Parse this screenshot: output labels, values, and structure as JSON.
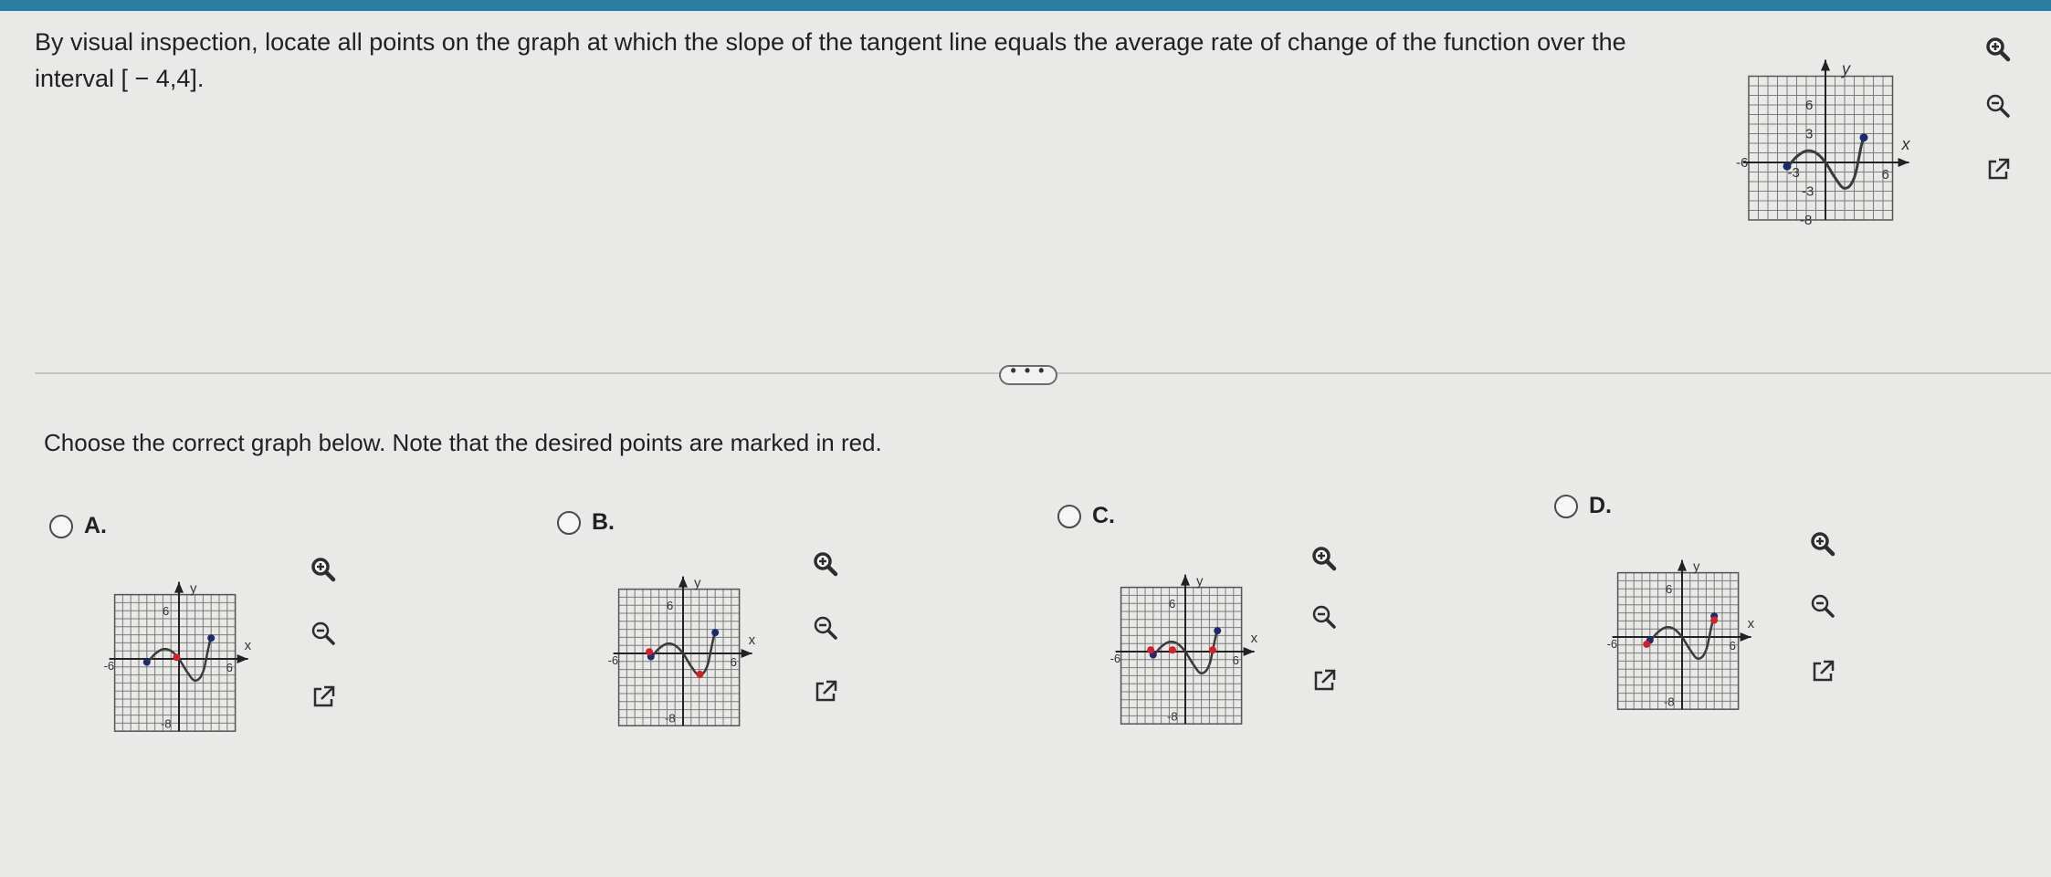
{
  "question": {
    "text": "By visual inspection, locate all points on the graph at which the slope of the tangent line equals the average rate of change of the function over the interval [ − 4,4]."
  },
  "more_button": {
    "label": "• • •"
  },
  "instruction": "Choose the correct graph below. Note that the desired points are marked in red.",
  "graph_labels": {
    "x": "x",
    "y": "y",
    "tick_6": "6",
    "tick_3": "3",
    "tick_neg3": "-3",
    "tick_neg6": "-6",
    "tick_neg8": "-8"
  },
  "colors": {
    "curve": "#3a3a3a",
    "endpoint": "#1c2b6e",
    "marked": "#d3202a",
    "grid": "#7b7b7b",
    "background": "#e9e9e7"
  },
  "icons": {
    "zoom_in": "zoom-in-icon",
    "zoom_out": "zoom-out-icon",
    "popout": "popout-icon"
  },
  "options": [
    {
      "letter": "A.",
      "red_points": [
        [
          -0.3,
          0.2
        ]
      ]
    },
    {
      "letter": "B.",
      "red_points": [
        [
          -4.2,
          0.2
        ],
        [
          2.1,
          -2.6
        ]
      ]
    },
    {
      "letter": "C.",
      "red_points": [
        [
          -4.3,
          0.2
        ],
        [
          -1.6,
          0.2
        ],
        [
          3.4,
          0.2
        ]
      ]
    },
    {
      "letter": "D.",
      "red_points": [
        [
          -4.4,
          -0.9
        ],
        [
          4.0,
          2.1
        ]
      ]
    }
  ]
}
